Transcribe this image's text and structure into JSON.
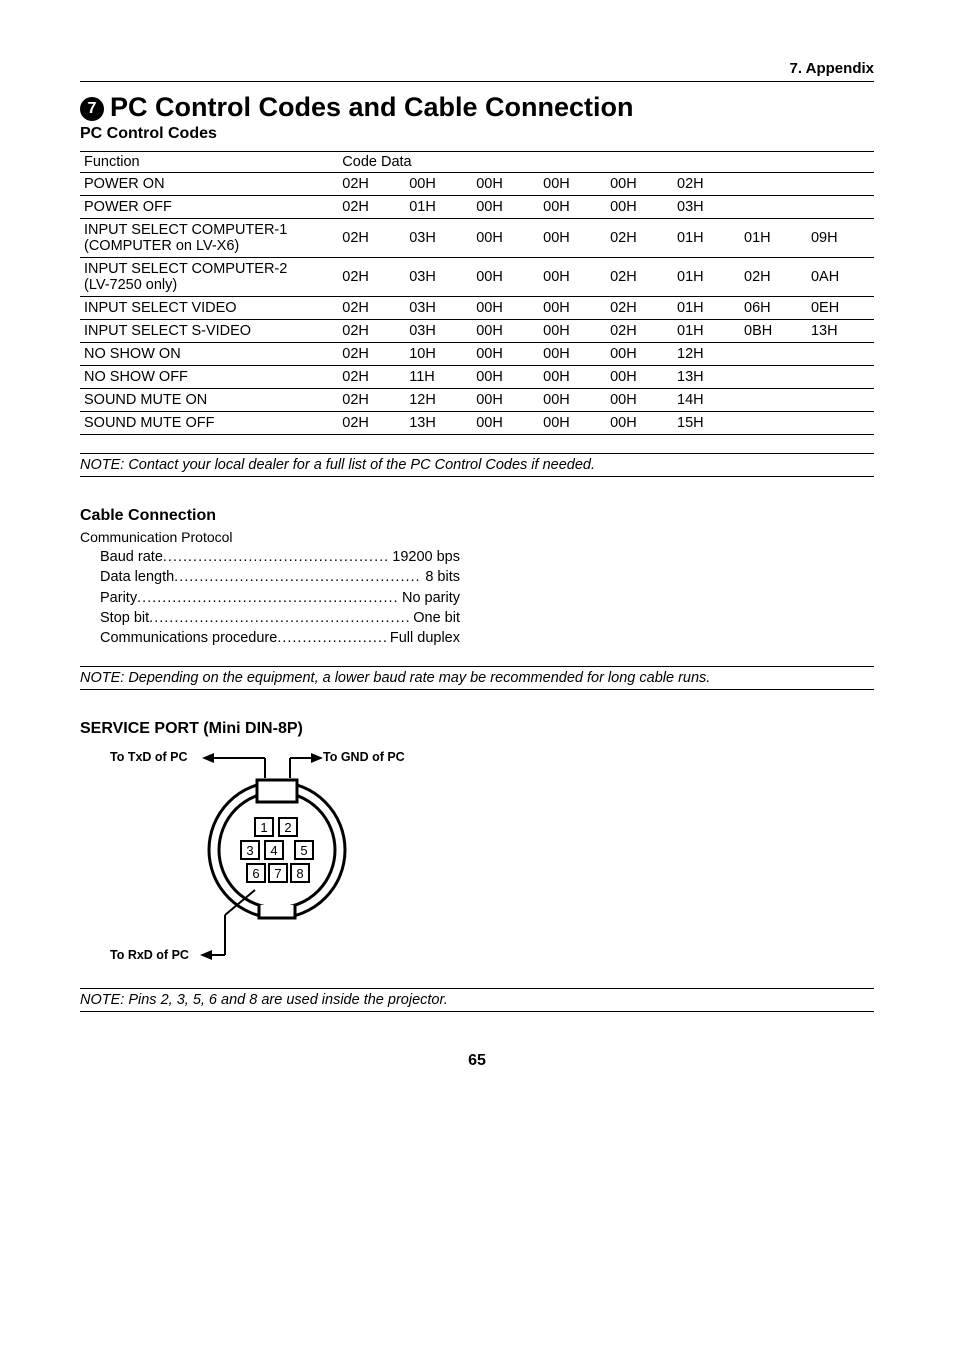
{
  "header": {
    "appendix_label": "7. Appendix"
  },
  "section": {
    "number": "7",
    "title": "PC Control Codes and Cable Connection"
  },
  "codes": {
    "heading": "PC Control Codes",
    "th_function": "Function",
    "th_codedata": "Code Data",
    "rows": [
      {
        "func": "POWER ON",
        "c": [
          "02H",
          "00H",
          "00H",
          "00H",
          "00H",
          "02H",
          "",
          ""
        ]
      },
      {
        "func": "POWER OFF",
        "c": [
          "02H",
          "01H",
          "00H",
          "00H",
          "00H",
          "03H",
          "",
          ""
        ]
      },
      {
        "func": "INPUT SELECT COMPUTER-1 (COMPUTER on LV-X6)",
        "c": [
          "02H",
          "03H",
          "00H",
          "00H",
          "02H",
          "01H",
          "01H",
          "09H"
        ]
      },
      {
        "func": "INPUT SELECT COMPUTER-2 (LV-7250 only)",
        "c": [
          "02H",
          "03H",
          "00H",
          "00H",
          "02H",
          "01H",
          "02H",
          "0AH"
        ]
      },
      {
        "func": "INPUT SELECT VIDEO",
        "c": [
          "02H",
          "03H",
          "00H",
          "00H",
          "02H",
          "01H",
          "06H",
          "0EH"
        ]
      },
      {
        "func": "INPUT SELECT S-VIDEO",
        "c": [
          "02H",
          "03H",
          "00H",
          "00H",
          "02H",
          "01H",
          "0BH",
          "13H"
        ]
      },
      {
        "func": "NO SHOW ON",
        "c": [
          "02H",
          "10H",
          "00H",
          "00H",
          "00H",
          "12H",
          "",
          ""
        ]
      },
      {
        "func": "NO SHOW OFF",
        "c": [
          "02H",
          "11H",
          "00H",
          "00H",
          "00H",
          "13H",
          "",
          ""
        ]
      },
      {
        "func": "SOUND MUTE ON",
        "c": [
          "02H",
          "12H",
          "00H",
          "00H",
          "00H",
          "14H",
          "",
          ""
        ]
      },
      {
        "func": "SOUND MUTE OFF",
        "c": [
          "02H",
          "13H",
          "00H",
          "00H",
          "00H",
          "15H",
          "",
          ""
        ]
      }
    ],
    "note": "NOTE: Contact your local dealer for a full list of the PC Control Codes if needed."
  },
  "cable": {
    "heading": "Cable Connection",
    "protocol_title": "Communication Protocol",
    "items": [
      {
        "label": "Baud rate",
        "value": "19200 bps"
      },
      {
        "label": "Data length",
        "value": "8 bits"
      },
      {
        "label": "Parity",
        "value": "No parity"
      },
      {
        "label": "Stop bit",
        "value": "One bit"
      },
      {
        "label": "Communications procedure",
        "value": "Full duplex"
      }
    ],
    "note": "NOTE: Depending on the equipment, a lower baud rate may be recommended for long cable runs."
  },
  "service": {
    "heading": "SERVICE PORT (Mini DIN-8P)",
    "labels": {
      "txd": "To TxD of PC",
      "gnd": "To GND of PC",
      "rxd": "To RxD of PC"
    },
    "pins": [
      "1",
      "2",
      "3",
      "4",
      "5",
      "6",
      "7",
      "8"
    ],
    "note": "NOTE: Pins 2, 3, 5, 6 and 8 are used inside the projector."
  },
  "page_number": "65"
}
